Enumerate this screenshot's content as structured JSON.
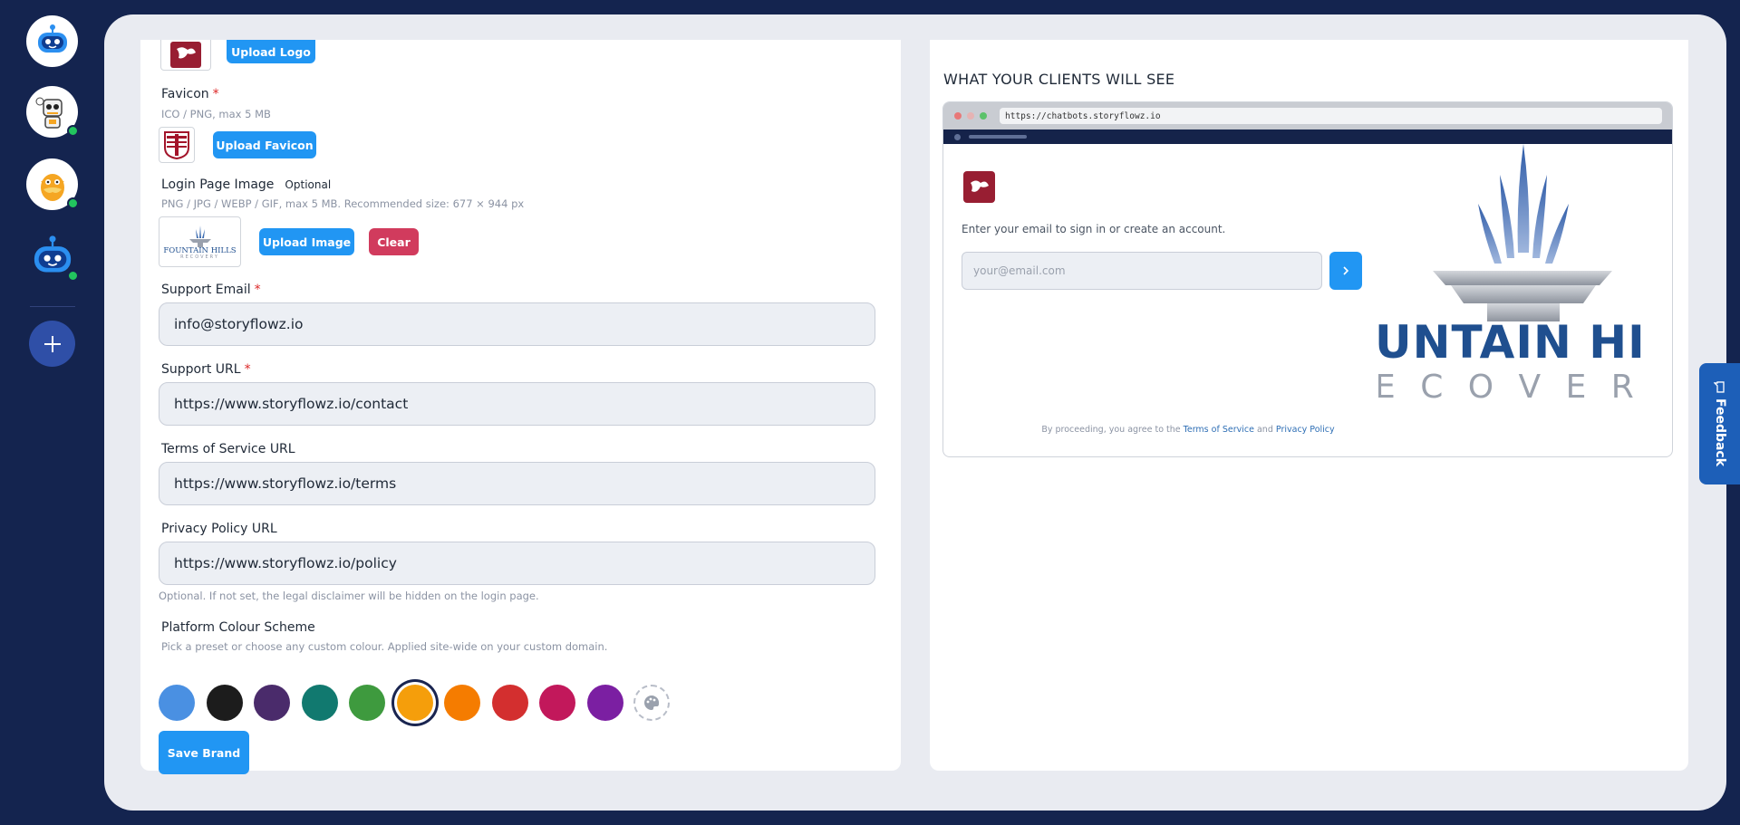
{
  "sidebar": {
    "bots": [
      {
        "name": "bot-1",
        "online": false
      },
      {
        "name": "bot-2",
        "online": true
      },
      {
        "name": "bot-3",
        "online": true
      },
      {
        "name": "bot-4",
        "online": true
      }
    ],
    "add_icon": "plus-icon"
  },
  "form": {
    "logo_upload_label": "Upload Logo",
    "favicon": {
      "label": "Favicon",
      "required": "*",
      "hint": "ICO / PNG, max 5 MB",
      "upload_label": "Upload Favicon"
    },
    "login_image": {
      "label": "Login Page Image",
      "optional": "Optional",
      "hint": "PNG / JPG / WEBP / GIF, max 5 MB. Recommended size: 677 × 944 px",
      "upload_label": "Upload Image",
      "clear_label": "Clear",
      "thumb_text": "FOUNTAIN HILLS",
      "thumb_sub": "RECOVERY"
    },
    "support_email": {
      "label": "Support Email",
      "required": "*",
      "value": "info@storyflowz.io"
    },
    "support_url": {
      "label": "Support URL",
      "required": "*",
      "value": "https://www.storyflowz.io/contact"
    },
    "terms_url": {
      "label": "Terms of Service URL",
      "value": "https://www.storyflowz.io/terms"
    },
    "privacy_url": {
      "label": "Privacy Policy URL",
      "value": "https://www.storyflowz.io/policy",
      "hint": "Optional. If not set, the legal disclaimer will be hidden on the login page."
    },
    "colour_scheme": {
      "label": "Platform Colour Scheme",
      "hint": "Pick a preset or choose any custom colour. Applied site-wide on your custom domain.",
      "swatches": [
        "#4a90e2",
        "#1c1c1c",
        "#4a2b6b",
        "#11796f",
        "#3e9a3e",
        "#f59e0b",
        "#f57c00",
        "#d32f2f",
        "#c2185b",
        "#7b1fa2"
      ],
      "selected": "#f59e0b",
      "custom_icon": "palette-icon"
    },
    "save_label": "Save Brand"
  },
  "preview": {
    "title": "WHAT YOUR CLIENTS WILL SEE",
    "url": "https://chatbots.storyflowz.io",
    "login_hint": "Enter your email to sign in or create an account.",
    "email_placeholder": "your@email.com",
    "legal_prefix": "By proceeding, you agree to the",
    "terms_link": "Terms of Service",
    "and": "and",
    "privacy_link": "Privacy Policy",
    "hero_line1": "UNTAIN HI",
    "hero_line2": "E C O V E R"
  },
  "feedback_label": "Feedback",
  "colors": {
    "bg_navy": "#14244f",
    "accent_blue": "#2196f3",
    "clear_red": "#d13b5d",
    "online_green": "#22c55e"
  }
}
